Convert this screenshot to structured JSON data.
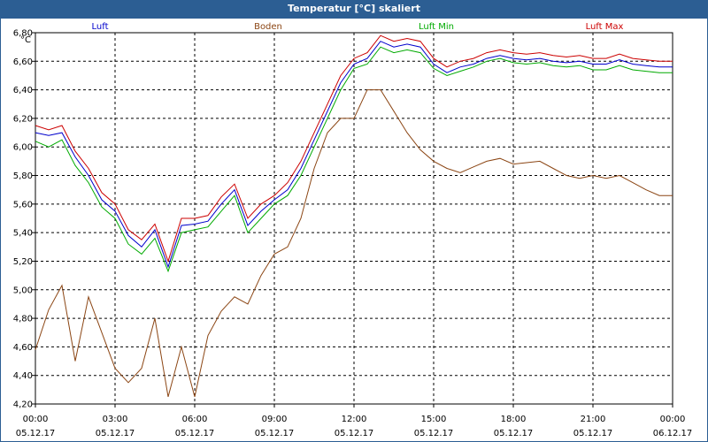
{
  "window_title": "Temperatur [°C] skaliert",
  "chart_data": {
    "type": "line",
    "title": "Temperatur [°C] skaliert",
    "ylabel": "°C",
    "ylim": [
      4.2,
      6.8
    ],
    "xlim": [
      0,
      24
    ],
    "grid": true,
    "legend_position": "top",
    "yticks": [
      "4,20",
      "4,40",
      "4,60",
      "4,80",
      "5,00",
      "5,20",
      "5,40",
      "5,60",
      "5,80",
      "6,00",
      "6,20",
      "6,40",
      "6,60",
      "6,80"
    ],
    "xticks": [
      {
        "time": "00:00",
        "date": "05.12.17"
      },
      {
        "time": "03:00",
        "date": "05.12.17"
      },
      {
        "time": "06:00",
        "date": "05.12.17"
      },
      {
        "time": "09:00",
        "date": "05.12.17"
      },
      {
        "time": "12:00",
        "date": "05.12.17"
      },
      {
        "time": "15:00",
        "date": "05.12.17"
      },
      {
        "time": "18:00",
        "date": "05.12.17"
      },
      {
        "time": "21:00",
        "date": "05.12.17"
      },
      {
        "time": "00:00",
        "date": "06.12.17"
      }
    ],
    "x": [
      0.0,
      0.5,
      1.0,
      1.5,
      2.0,
      2.5,
      3.0,
      3.5,
      4.0,
      4.5,
      5.0,
      5.5,
      6.0,
      6.5,
      7.0,
      7.5,
      8.0,
      8.5,
      9.0,
      9.5,
      10.0,
      10.5,
      11.0,
      11.5,
      12.0,
      12.5,
      13.0,
      13.5,
      14.0,
      14.5,
      15.0,
      15.5,
      16.0,
      16.5,
      17.0,
      17.5,
      18.0,
      18.5,
      19.0,
      19.5,
      20.0,
      20.5,
      21.0,
      21.5,
      22.0,
      22.5,
      23.0,
      23.5,
      24.0
    ],
    "series": [
      {
        "name": "Luft",
        "color": "#0000cc",
        "values": [
          6.1,
          6.08,
          6.1,
          5.93,
          5.8,
          5.63,
          5.55,
          5.38,
          5.3,
          5.42,
          5.16,
          5.45,
          5.46,
          5.48,
          5.6,
          5.7,
          5.45,
          5.55,
          5.63,
          5.7,
          5.85,
          6.05,
          6.25,
          6.45,
          6.58,
          6.62,
          6.74,
          6.7,
          6.72,
          6.7,
          6.58,
          6.52,
          6.56,
          6.58,
          6.62,
          6.64,
          6.62,
          6.61,
          6.62,
          6.6,
          6.59,
          6.6,
          6.58,
          6.58,
          6.61,
          6.58,
          6.57,
          6.56,
          6.56
        ]
      },
      {
        "name": "Boden",
        "color": "#8b4513",
        "values": [
          4.58,
          4.86,
          5.03,
          4.5,
          4.95,
          4.7,
          4.45,
          4.35,
          4.45,
          4.8,
          4.25,
          4.6,
          4.25,
          4.68,
          4.85,
          4.95,
          4.9,
          5.1,
          5.25,
          5.3,
          5.5,
          5.85,
          6.1,
          6.2,
          6.2,
          6.4,
          6.4,
          6.25,
          6.1,
          5.98,
          5.9,
          5.85,
          5.82,
          5.86,
          5.9,
          5.92,
          5.88,
          5.89,
          5.9,
          5.85,
          5.8,
          5.78,
          5.8,
          5.78,
          5.8,
          5.75,
          5.7,
          5.66,
          5.66
        ]
      },
      {
        "name": "Luft Min",
        "color": "#00aa00",
        "values": [
          6.04,
          6.0,
          6.05,
          5.87,
          5.75,
          5.58,
          5.5,
          5.32,
          5.25,
          5.36,
          5.13,
          5.4,
          5.42,
          5.44,
          5.55,
          5.66,
          5.4,
          5.5,
          5.6,
          5.66,
          5.8,
          6.0,
          6.2,
          6.4,
          6.55,
          6.58,
          6.7,
          6.66,
          6.68,
          6.66,
          6.55,
          6.5,
          6.53,
          6.56,
          6.6,
          6.62,
          6.59,
          6.58,
          6.59,
          6.57,
          6.56,
          6.57,
          6.54,
          6.54,
          6.57,
          6.54,
          6.53,
          6.52,
          6.52
        ]
      },
      {
        "name": "Luft Max",
        "color": "#cc0000",
        "values": [
          6.15,
          6.12,
          6.15,
          5.97,
          5.85,
          5.68,
          5.6,
          5.42,
          5.35,
          5.46,
          5.2,
          5.5,
          5.5,
          5.52,
          5.65,
          5.74,
          5.5,
          5.6,
          5.66,
          5.75,
          5.9,
          6.1,
          6.3,
          6.5,
          6.62,
          6.66,
          6.78,
          6.74,
          6.76,
          6.74,
          6.62,
          6.56,
          6.6,
          6.62,
          6.66,
          6.68,
          6.66,
          6.65,
          6.66,
          6.64,
          6.63,
          6.64,
          6.62,
          6.62,
          6.65,
          6.62,
          6.61,
          6.6,
          6.6
        ]
      }
    ]
  }
}
